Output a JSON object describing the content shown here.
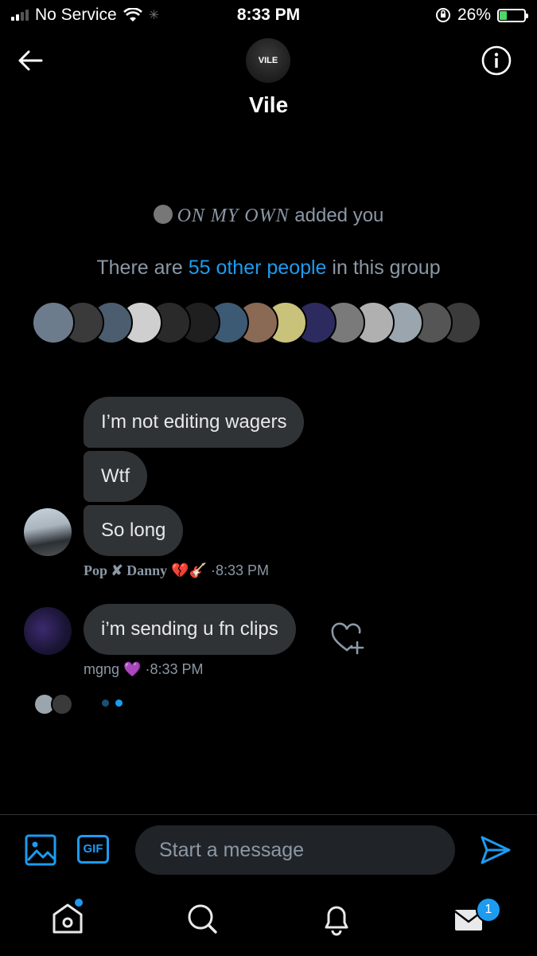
{
  "status_bar": {
    "carrier": "No Service",
    "time": "8:33 PM",
    "battery": "26%"
  },
  "header": {
    "group_avatar_text": "VILE",
    "title": "Vile"
  },
  "system": {
    "added_by": "ON MY OWN",
    "added_suffix": "added you",
    "people_prefix": "There are",
    "people_link": "55 other people",
    "people_suffix": "in this group",
    "member_avatar_colors": [
      "#6d7c8c",
      "#3a3a3a",
      "#4b5d6e",
      "#cfcfcf",
      "#2a2a2a",
      "#1f1f1f",
      "#3d5a75",
      "#8a6a55",
      "#c9c27a",
      "#2c2a5e",
      "#7a7a7a",
      "#b0b0b0",
      "#9aa5ad",
      "#555555",
      "#3b3b3b"
    ]
  },
  "messages": [
    {
      "text": "I’m not editing wagers"
    },
    {
      "text": "Wtf"
    },
    {
      "text": "So long"
    },
    {
      "text": "i’m sending u fn clips"
    }
  ],
  "meta": [
    {
      "name": "Pop ✘ Danny",
      "emoji": "💔🎸",
      "time": "·8:33 PM"
    },
    {
      "name": "mgng",
      "emoji": "💜",
      "time": "·8:33 PM"
    }
  ],
  "composer": {
    "gif_label": "GIF",
    "placeholder": "Start a message"
  },
  "tabs": {
    "messages_badge": "1"
  }
}
